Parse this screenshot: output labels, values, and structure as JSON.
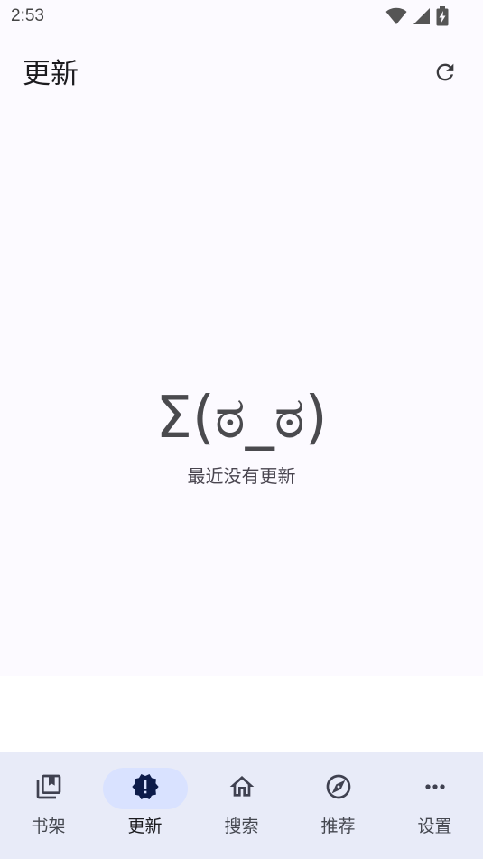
{
  "status_bar": {
    "time": "2:53",
    "icons": [
      "wifi-icon",
      "signal-icon",
      "battery-charging-icon"
    ]
  },
  "top_bar": {
    "title": "更新",
    "refresh_icon": "refresh-icon"
  },
  "empty_state": {
    "face": "Σ(ಠ_ಠ)",
    "message": "最近没有更新"
  },
  "bottom_nav": {
    "items": [
      {
        "label": "书架",
        "icon": "bookshelf-icon",
        "active": false
      },
      {
        "label": "更新",
        "icon": "new-releases-icon",
        "active": true
      },
      {
        "label": "搜索",
        "icon": "home-icon",
        "active": false
      },
      {
        "label": "推荐",
        "icon": "compass-icon",
        "active": false
      },
      {
        "label": "设置",
        "icon": "more-horiz-icon",
        "active": false
      }
    ]
  },
  "colors": {
    "surface": "#fcfaff",
    "nav_background": "#e8ebf8",
    "active_indicator": "#d9e2ff",
    "active_icon": "#0d1c4a"
  }
}
